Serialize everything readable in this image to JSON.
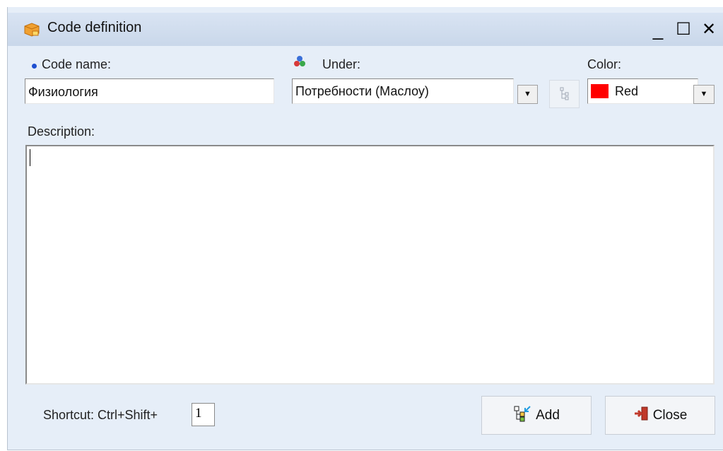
{
  "window": {
    "title": "Code definition",
    "minimize_glyph": "_",
    "maximize_glyph": "☐",
    "close_glyph": "✕"
  },
  "form": {
    "code_name_label": "Code name:",
    "code_name_value": "Физиология",
    "under_label": "Under:",
    "under_value": "Потребности (Маслоу)",
    "color_label": "Color:",
    "color_value": "Red",
    "color_swatch": "#ff0000",
    "description_label": "Description:",
    "description_value": ""
  },
  "footer": {
    "shortcut_label": "Shortcut: Ctrl+Shift+",
    "shortcut_value": "1",
    "add_label": "Add",
    "close_label": "Close"
  },
  "icons": {
    "title": "code-definition-app-icon",
    "bullet": "blue-dot-icon",
    "under": "tri-color-code-icon",
    "tree": "code-tree-icon",
    "add": "add-code-icon",
    "close": "exit-door-icon"
  }
}
